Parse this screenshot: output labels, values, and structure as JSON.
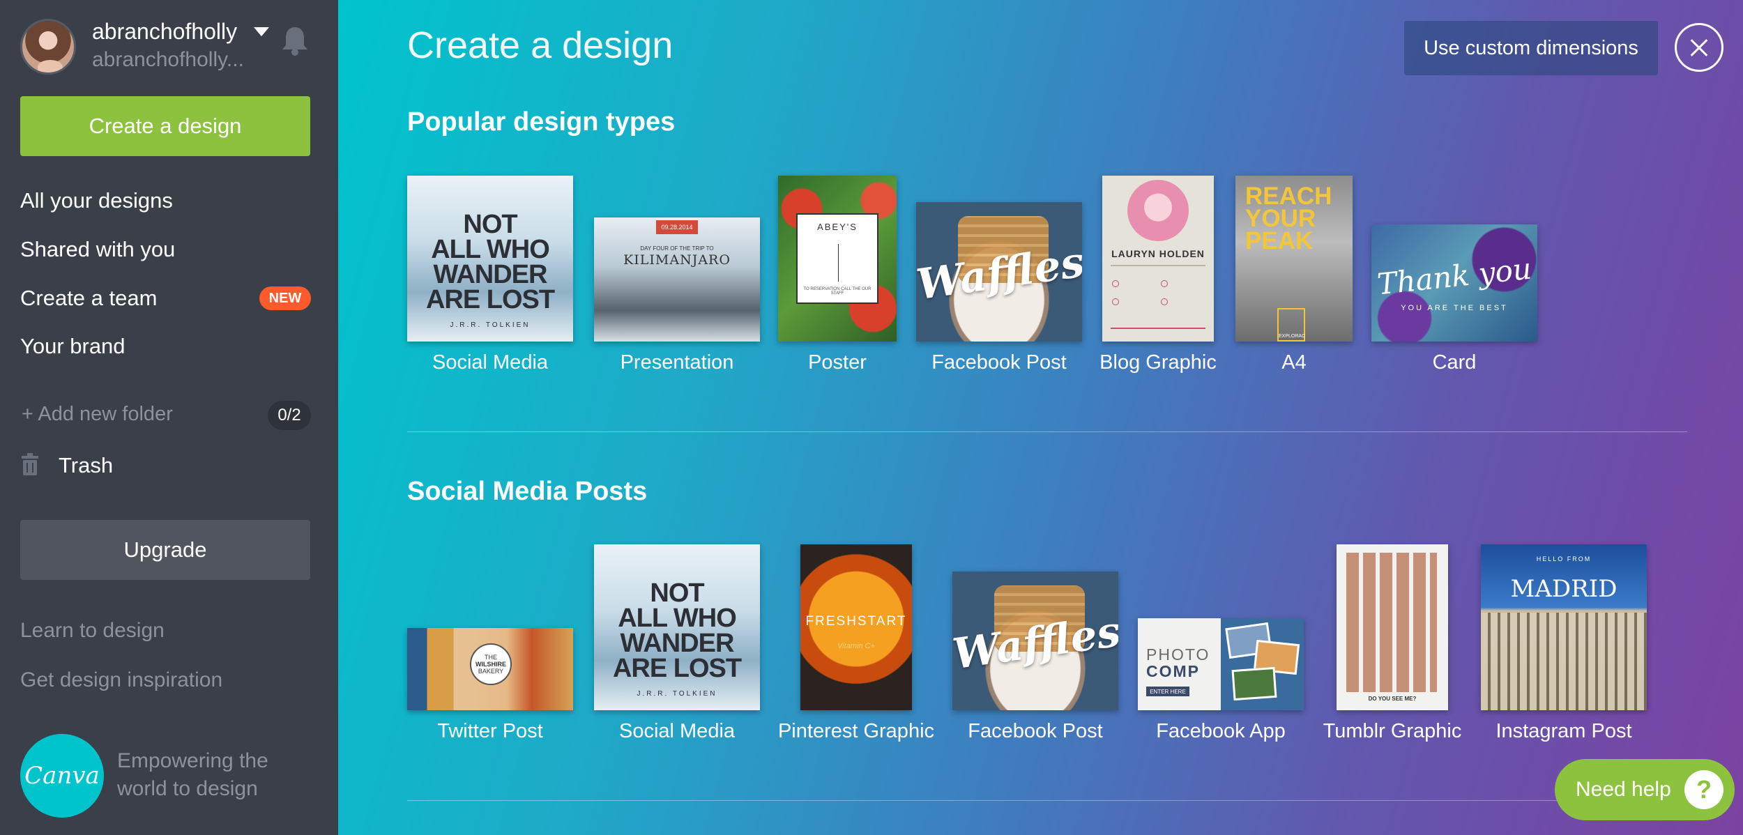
{
  "user": {
    "name": "abranchofholly",
    "email": "abranchofholly..."
  },
  "sidebar": {
    "create_label": "Create a design",
    "nav": [
      {
        "label": "All your designs"
      },
      {
        "label": "Shared with you"
      },
      {
        "label": "Create a team",
        "badge": "NEW"
      },
      {
        "label": "Your brand"
      }
    ],
    "add_folder_label": "+ Add new folder",
    "folder_count": "0/2",
    "trash_label": "Trash",
    "upgrade_label": "Upgrade",
    "learn_label": "Learn to design",
    "inspiration_label": "Get design inspiration",
    "logo_text": "Canva",
    "tagline": "Empowering the world to design"
  },
  "main": {
    "title": "Create a design",
    "custom_dimensions_label": "Use custom dimensions",
    "sections": [
      {
        "title": "Popular design types",
        "items": [
          {
            "label": "Social Media",
            "thumb_text": [
              "NOT",
              "ALL WHO",
              "WANDER",
              "ARE LOST"
            ],
            "thumb_sub": "J.R.R. TOLKIEN"
          },
          {
            "label": "Presentation",
            "thumb_tag": "09.28.2014",
            "thumb_sub": "DAY FOUR OF THE TRIP TO",
            "thumb_big": "KILIMANJARO"
          },
          {
            "label": "Poster",
            "thumb_title": "ABEY'S",
            "thumb_sub": "TO RESERVATION CALL THE OUR STAFF"
          },
          {
            "label": "Facebook Post",
            "thumb_script": "Waffles"
          },
          {
            "label": "Blog Graphic",
            "thumb_name": "LAURYN HOLDEN"
          },
          {
            "label": "A4",
            "thumb_big": [
              "REACH",
              "YOUR",
              "PEAK"
            ],
            "thumb_sub": "EXPLORAC"
          },
          {
            "label": "Card",
            "thumb_script": "Thank you",
            "thumb_sub": "YOU ARE THE BEST"
          }
        ]
      },
      {
        "title": "Social Media Posts",
        "items": [
          {
            "label": "Twitter Post",
            "thumb_text": [
              "THE",
              "WILSHIRE",
              "BAKERY"
            ]
          },
          {
            "label": "Social Media",
            "thumb_text": [
              "NOT",
              "ALL WHO",
              "WANDER",
              "ARE LOST"
            ],
            "thumb_sub": "J.R.R. TOLKIEN"
          },
          {
            "label": "Pinterest Graphic",
            "thumb_big": "FRESHSTART",
            "thumb_sub": "Vitamin C+"
          },
          {
            "label": "Facebook Post",
            "thumb_script": "Waffles"
          },
          {
            "label": "Facebook App",
            "thumb_big": [
              "PHOTO",
              "COMP"
            ],
            "thumb_sub": "ENTER HERE"
          },
          {
            "label": "Tumblr Graphic",
            "thumb_sub": "DO YOU SEE ME?"
          },
          {
            "label": "Instagram Post",
            "thumb_sub": "HELLO FROM",
            "thumb_big": "MADRID"
          }
        ]
      }
    ]
  },
  "help_label": "Need help",
  "help_icon": "?"
}
